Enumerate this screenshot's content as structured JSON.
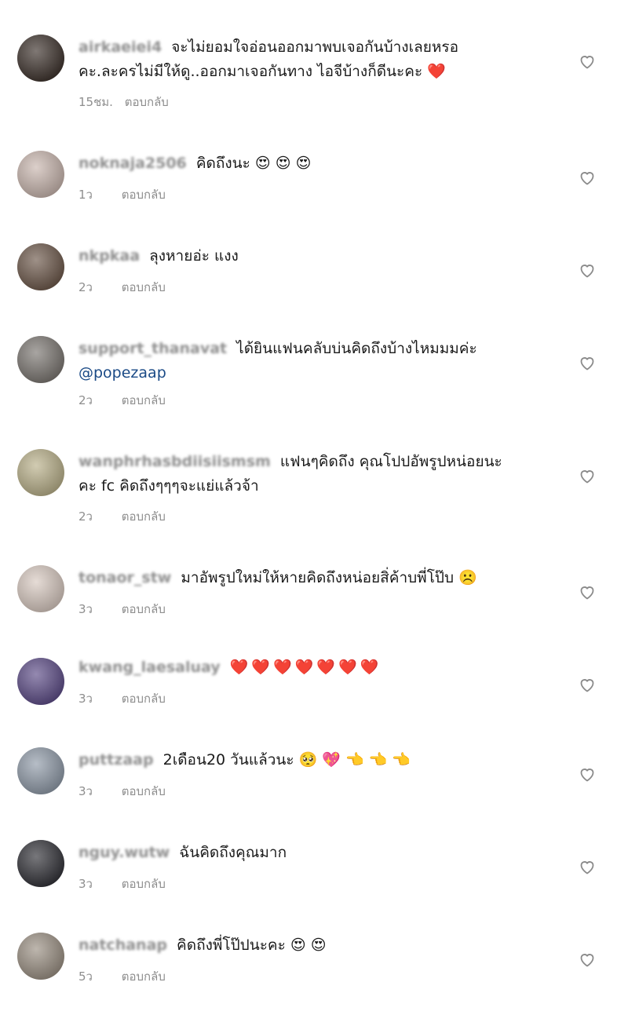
{
  "reply_label": "ตอบกลับ",
  "comments": [
    {
      "username": "airkaeiei4",
      "text": "จะไม่ยอมใจอ่อนออกมาพบเจอกันบ้างเลยหรอ",
      "text2": "คะ.ละครไม่มีให้ดู..ออกมาเจอกันทาง ไอจีบ้างก็ดีนะคะ",
      "emoji": "❤️",
      "time": "15ชม.",
      "avatar_color": "#3b302a"
    },
    {
      "username": "noknaja2506",
      "text": "คิดถึงนะ",
      "text2": "",
      "emoji": "😍 😍 😍",
      "time": "1ว",
      "avatar_color": "#c9b6ae"
    },
    {
      "username": "nkpkaa",
      "text": "ลุงหายอ่ะ แงง",
      "text2": "",
      "emoji": "",
      "time": "2ว",
      "avatar_color": "#6b5648"
    },
    {
      "username": "support_thanavat",
      "text": "ได้ยินแฟนคลับบ่นคิดถึงบ้างไหมมมค่ะ",
      "text2": "",
      "mention": "@popezaap",
      "emoji": "",
      "time": "2ว",
      "avatar_color": "#7a7570"
    },
    {
      "username": "wanphrhasbdiisiismsm",
      "text": "แฟนๆคิดถึง คุณโปปอัพรูปหน่อยนะ",
      "text2": "คะ fc คิดถึงๆๆๆจะแย่แล้วจ้า",
      "emoji": "",
      "time": "2ว",
      "avatar_color": "#b9b089"
    },
    {
      "username": "tonaor_stw",
      "text": "มาอัพรูปใหม่ให้หายคิดถึงหน่อยสิ่ค้าบพี่โป๊บ",
      "text2": "",
      "emoji": "☹️",
      "time": "3ว",
      "avatar_color": "#d8c9c0"
    },
    {
      "username": "kwang_laesaluay",
      "text": "",
      "text2": "",
      "emoji": "❤️❤️❤️❤️❤️❤️❤️",
      "time": "3ว",
      "avatar_color": "#5b4a86"
    },
    {
      "username": "puttzaap",
      "text": "2เดือน20 วันแล้วนะ",
      "text2": "",
      "emoji": "🥺 💖 👈 👈 👈",
      "time": "3ว",
      "avatar_color": "#8f9aa8"
    },
    {
      "username": "nguy.wutw",
      "text": "ฉันคิดถึงคุณมาก",
      "text2": "",
      "emoji": "",
      "time": "3ว",
      "avatar_color": "#2f2f35"
    },
    {
      "username": "natchanap",
      "text": "คิดถึงพี่โป๊ปนะคะ",
      "text2": "",
      "emoji": "😍 😍",
      "time": "5ว",
      "avatar_color": "#9a8f82"
    }
  ],
  "colors": {
    "heart": "#e0243a",
    "meta": "#8e8e8e",
    "mention": "#1a4a86"
  },
  "icons": {
    "like": "heart-outline-icon"
  }
}
